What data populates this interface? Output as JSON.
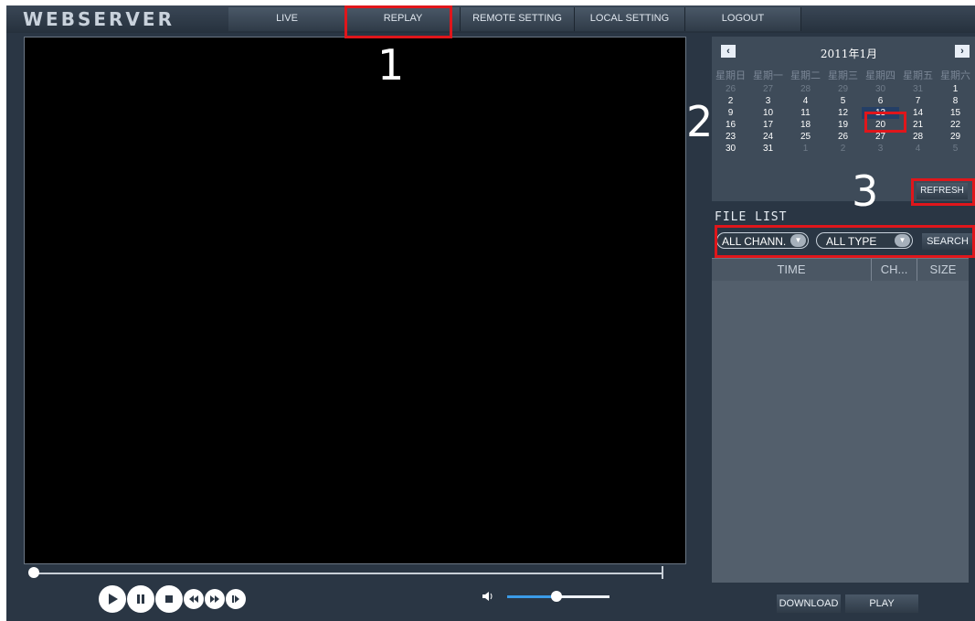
{
  "header": {
    "logo": "WEBSERVER",
    "nav": [
      "LIVE",
      "REPLAY",
      "REMOTE SETTING",
      "LOCAL SETTING",
      "LOGOUT"
    ]
  },
  "calendar": {
    "title": "2011年1月",
    "prev_icon": "chevron-left-icon",
    "next_icon": "chevron-right-icon",
    "weekdays": [
      "星期日",
      "星期一",
      "星期二",
      "星期三",
      "星期四",
      "星期五",
      "星期六"
    ],
    "days": [
      {
        "n": "26",
        "dim": true
      },
      {
        "n": "27",
        "dim": true
      },
      {
        "n": "28",
        "dim": true
      },
      {
        "n": "29",
        "dim": true
      },
      {
        "n": "30",
        "dim": true
      },
      {
        "n": "31",
        "dim": true
      },
      {
        "n": "1"
      },
      {
        "n": "2"
      },
      {
        "n": "3"
      },
      {
        "n": "4"
      },
      {
        "n": "5"
      },
      {
        "n": "6"
      },
      {
        "n": "7"
      },
      {
        "n": "8"
      },
      {
        "n": "9"
      },
      {
        "n": "10"
      },
      {
        "n": "11"
      },
      {
        "n": "12"
      },
      {
        "n": "13",
        "selected": true
      },
      {
        "n": "14"
      },
      {
        "n": "15"
      },
      {
        "n": "16"
      },
      {
        "n": "17"
      },
      {
        "n": "18"
      },
      {
        "n": "19"
      },
      {
        "n": "20"
      },
      {
        "n": "21"
      },
      {
        "n": "22"
      },
      {
        "n": "23"
      },
      {
        "n": "24"
      },
      {
        "n": "25"
      },
      {
        "n": "26"
      },
      {
        "n": "27"
      },
      {
        "n": "28"
      },
      {
        "n": "29"
      },
      {
        "n": "30"
      },
      {
        "n": "31"
      },
      {
        "n": "1",
        "dim": true
      },
      {
        "n": "2",
        "dim": true
      },
      {
        "n": "3",
        "dim": true
      },
      {
        "n": "4",
        "dim": true
      },
      {
        "n": "5",
        "dim": true
      }
    ],
    "refresh_label": "REFRESH"
  },
  "file_list": {
    "title": "FILE LIST",
    "channel_select": "ALL CHANN.",
    "type_select": "ALL TYPE",
    "search_label": "SEARCH",
    "columns": [
      "TIME",
      "CH...",
      "SIZE"
    ],
    "download_label": "DOWNLOAD",
    "play_label": "PLAY"
  },
  "playback": {
    "controls": [
      "play-icon",
      "pause-icon",
      "stop-icon",
      "rewind-icon",
      "fast-forward-icon",
      "step-frame-icon"
    ],
    "volume_icon": "speaker-icon",
    "seek_position": 0.0,
    "volume_level": 0.48
  },
  "annotations": [
    "1",
    "2",
    "3"
  ],
  "colors": {
    "highlight": "#e0161b",
    "background": "#2a3644",
    "video": "#000000"
  }
}
